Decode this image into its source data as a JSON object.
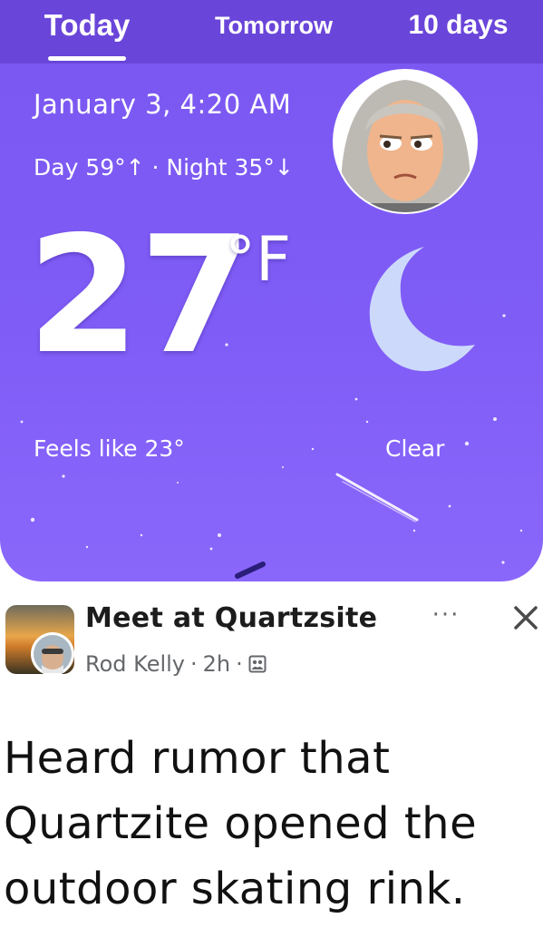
{
  "tabs": {
    "items": [
      {
        "label": "Today",
        "active": true
      },
      {
        "label": "Tomorrow",
        "active": false
      },
      {
        "label": "10 days",
        "active": false
      }
    ]
  },
  "weather": {
    "datetime": "January 3, 4:20 AM",
    "day_night": "Day 59°↑ · Night 35°↓",
    "temperature": "27",
    "unit": "°F",
    "feels_like": "Feels like 23°",
    "condition": "Clear",
    "condition_icon": "crescent-moon-icon",
    "colors": {
      "card": "#7f5cf6",
      "tabbar": "#6a45d9",
      "moon": "#cdd9fb"
    }
  },
  "post": {
    "title": "Meet at Quartzsite",
    "author": "Rod Kelly",
    "sep1": "·",
    "age": "2h",
    "sep2": "·",
    "audience_icon": "group-icon",
    "more_label": "···",
    "close_icon": "close-icon",
    "body": "Heard rumor that Quartzite opened the outdoor skating rink."
  }
}
